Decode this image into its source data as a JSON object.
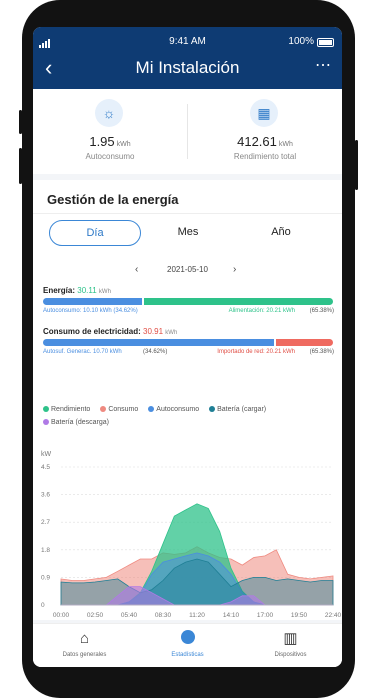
{
  "status": {
    "time": "9:41 AM",
    "battery": "100%"
  },
  "header": {
    "title": "Mi Instalación"
  },
  "stats": [
    {
      "value": "1.95",
      "unit": "kWh",
      "label": "Autoconsumo",
      "icon": "solar-home-icon"
    },
    {
      "value": "412.61",
      "unit": "kWh",
      "label": "Rendimiento total",
      "icon": "solar-panel-icon"
    }
  ],
  "energy": {
    "title": "Gestión de la energía",
    "tabs": [
      "Día",
      "Mes",
      "Año"
    ],
    "active_tab": "Día",
    "date": "2021-05-10",
    "production": {
      "label": "Energía:",
      "value": "30.11",
      "unit": "kWh",
      "left_label": "Autoconsumo: 10.10 kWh (34.62%)",
      "right_label": "Alimentación: 20.21 kWh",
      "right_pct": "(65.38%)",
      "left_fraction": 0.3462
    },
    "consumption": {
      "label": "Consumo de electricidad:",
      "value": "30.91",
      "unit": "kWh",
      "left_label": "Autosuf. Generac. 10.70 kWh",
      "left_pct": "(34.62%)",
      "right_label": "Importado de red: 20.21 kWh",
      "right_pct": "(65.38%)",
      "left_fraction": 0.8
    },
    "legend": [
      {
        "name": "Rendimiento",
        "color": "#2ec28a"
      },
      {
        "name": "Consumo",
        "color": "#ef8a80"
      },
      {
        "name": "Autoconsumo",
        "color": "#4a8ee0"
      },
      {
        "name": "Batería (cargar)",
        "color": "#1f7f95"
      },
      {
        "name": "Batería (descarga)",
        "color": "#b07ae6"
      }
    ]
  },
  "chart_data": {
    "type": "area",
    "ylabel": "kW",
    "yticks": [
      "4.5",
      "3.6",
      "2.7",
      "1.8",
      "0.9",
      "0"
    ],
    "xticks": [
      "00:00",
      "02:50",
      "05:40",
      "08:30",
      "11:20",
      "14:10",
      "17:00",
      "19:50",
      "22:40"
    ],
    "ylim": [
      0,
      4.5
    ],
    "x": [
      0,
      1,
      2,
      3,
      4,
      5,
      6,
      7,
      8,
      9,
      10,
      11,
      12,
      13,
      14,
      15,
      16,
      17,
      18,
      19,
      20,
      21,
      22,
      23,
      24
    ],
    "series": [
      {
        "name": "Consumo",
        "values": [
          0.85,
          0.8,
          0.8,
          0.85,
          0.9,
          1.1,
          1.3,
          1.5,
          1.5,
          1.7,
          1.65,
          1.7,
          1.9,
          1.7,
          1.55,
          1.5,
          1.3,
          1.55,
          1.6,
          1.8,
          1.0,
          0.9,
          0.85,
          0.9,
          0.95
        ]
      },
      {
        "name": "Rendimiento",
        "values": [
          0,
          0,
          0,
          0,
          0,
          0,
          0.1,
          0.4,
          1.1,
          2.0,
          2.9,
          3.1,
          3.3,
          3.15,
          2.4,
          1.2,
          0.45,
          0.1,
          0,
          0,
          0,
          0,
          0,
          0,
          0
        ]
      },
      {
        "name": "Autoconsumo",
        "values": [
          0,
          0,
          0,
          0,
          0,
          0,
          0.1,
          0.35,
          1.0,
          1.4,
          1.5,
          1.6,
          1.7,
          1.6,
          1.4,
          1.0,
          0.4,
          0.1,
          0,
          0,
          0,
          0,
          0,
          0,
          0
        ]
      },
      {
        "name": "Batería (cargar)",
        "values": [
          0.75,
          0.72,
          0.72,
          0.75,
          0.8,
          0.85,
          0.6,
          0.4,
          0.5,
          0.8,
          1.2,
          1.4,
          1.5,
          1.4,
          1.0,
          0.6,
          0.8,
          0.9,
          0.9,
          0.8,
          0.85,
          0.8,
          0.75,
          0.8,
          0.8
        ]
      },
      {
        "name": "Batería (descarga)",
        "values": [
          0,
          0,
          0,
          0,
          0,
          0.3,
          0.6,
          0.6,
          0.4,
          0.2,
          0,
          0,
          0,
          0,
          0,
          0.1,
          0.3,
          0.3,
          0,
          0,
          0,
          0,
          0,
          0,
          0
        ]
      }
    ],
    "grid": true
  },
  "nav": [
    {
      "label": "Datos generales",
      "icon": "home-icon"
    },
    {
      "label": "Estadísticas",
      "icon": "pie-chart-icon"
    },
    {
      "label": "Dispositivos",
      "icon": "devices-icon"
    }
  ]
}
